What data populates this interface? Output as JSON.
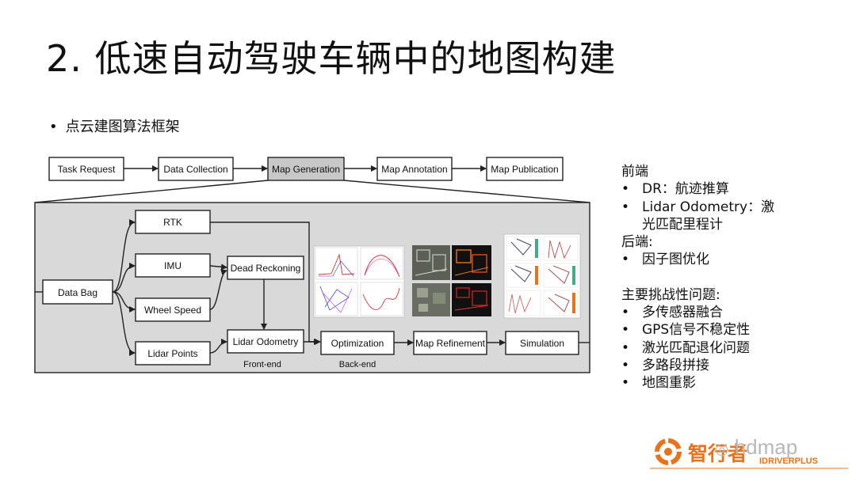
{
  "slide": {
    "title": "2. 低速自动驾驶车辆中的地图构建",
    "bullet": "点云建图算法框架"
  },
  "pipeline": {
    "task_request": "Task Request",
    "data_collection": "Data Collection",
    "map_generation": "Map Generation",
    "map_annotation": "Map Annotation",
    "map_publication": "Map Publication"
  },
  "detail": {
    "data_bag": "Data Bag",
    "rtk": "RTK",
    "imu": "IMU",
    "wheel_speed": "Wheel Speed",
    "lidar_points": "Lidar Points",
    "dead_reckoning": "Dead Reckoning",
    "lidar_odometry": "Lidar Odometry",
    "optimization": "Optimization",
    "map_refinement": "Map Refinement",
    "simulation": "Simulation",
    "front_end": "Front-end",
    "back_end": "Back-end"
  },
  "notes": {
    "frontend_title": "前端",
    "frontend_items": [
      "DR：航迹推算",
      "Lidar Odometry：激光匹配里程计"
    ],
    "backend_title": "后端:",
    "backend_items": [
      "因子图优化"
    ],
    "challenges_title": "主要挑战性问题:",
    "challenge_items": [
      "多传感器融合",
      "GPS信号不稳定性",
      "激光匹配退化问题",
      "多路段拼接",
      "地图重影"
    ]
  },
  "branding": {
    "watermark": "hdmap",
    "logo_cn": "智行者",
    "logo_en": "IDRIVERPLUS"
  },
  "colors": {
    "accent_orange": "#e8731a",
    "panel_gray": "#d9d9d9",
    "highlight_gray": "#c8c8c8"
  }
}
